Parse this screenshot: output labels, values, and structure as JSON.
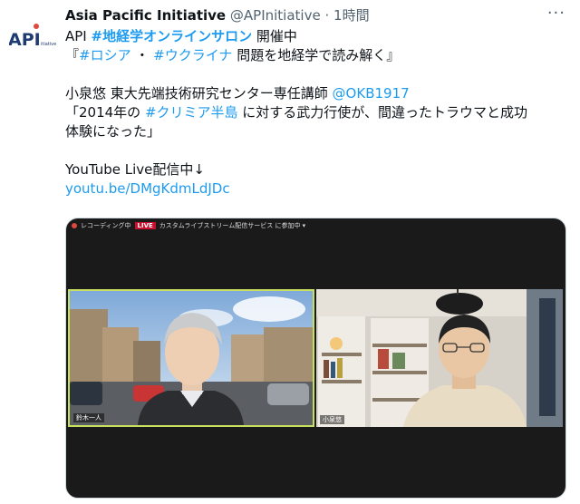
{
  "tweet": {
    "author_name": "Asia Pacific Initiative",
    "handle": "@APInitiative",
    "separator": "·",
    "time": "1時間",
    "more_icon": "more-dots-icon",
    "logo_text": "API"
  },
  "body": {
    "line1_prefix": "API ",
    "line1_tag": "#地経学オンラインサロン",
    "line1_suffix": " 開催中",
    "line2_open": "『",
    "line2_tag1": "#ロシア",
    "line2_mid": " ・ ",
    "line2_tag2": "#ウクライナ",
    "line2_suffix": " 問題を地経学で読み解く』",
    "line3_text": "小泉悠 東大先端技術研究センター専任講師 ",
    "line3_mention": "@OKB1917",
    "line4_prefix": "「2014年の ",
    "line4_tag": "#クリミア半島",
    "line4_suffix": " に対する武力行使が、間違ったトラウマと成功",
    "line5_text": "体験になった」",
    "line6_text": "YouTube Live配信中↓",
    "line7_link": "youtu.be/DMgKdmLdJDc"
  },
  "media": {
    "toolbar_recording": "レコーディング中",
    "toolbar_live": "LIVE",
    "toolbar_stream": "カスタムライブストリーム配信サービス に参加中 ▾",
    "left_participant_label": "鈴木一人",
    "right_participant_label": "小泉悠"
  },
  "colors": {
    "link": "#1d9bf0",
    "brand_navy": "#1f3b73",
    "live_red": "#c8102e",
    "active_speaker_border": "#c8e060"
  }
}
